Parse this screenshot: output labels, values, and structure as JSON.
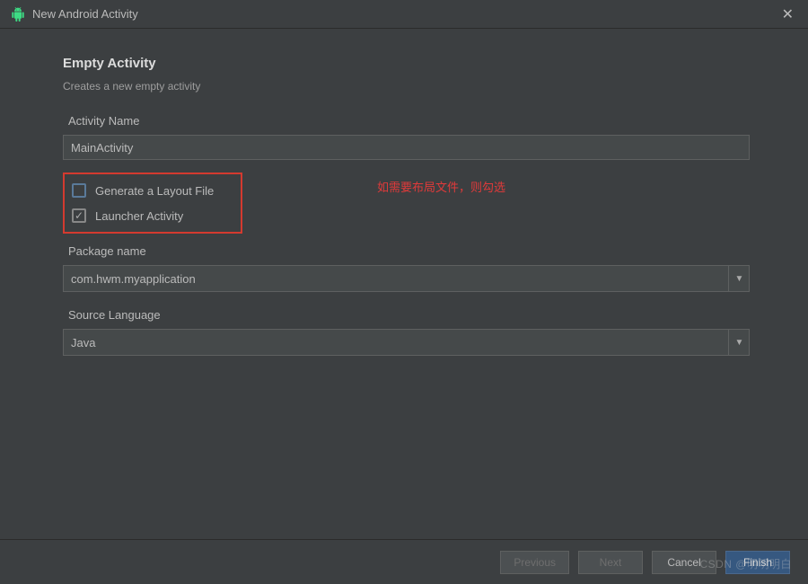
{
  "window": {
    "title": "New Android Activity"
  },
  "page": {
    "heading": "Empty Activity",
    "subheading": "Creates a new empty activity"
  },
  "fields": {
    "activity_name": {
      "label": "Activity Name",
      "value": "MainActivity"
    },
    "generate_layout": {
      "label": "Generate a Layout File",
      "checked": false
    },
    "launcher_activity": {
      "label": "Launcher Activity",
      "checked": true
    },
    "package_name": {
      "label": "Package name",
      "value": "com.hwm.myapplication"
    },
    "source_language": {
      "label": "Source Language",
      "value": "Java"
    }
  },
  "annotation": "如需要布局文件，则勾选",
  "buttons": {
    "previous": "Previous",
    "next": "Next",
    "cancel": "Cancel",
    "finish": "Finish"
  },
  "watermark": "CSDN @明明明白"
}
